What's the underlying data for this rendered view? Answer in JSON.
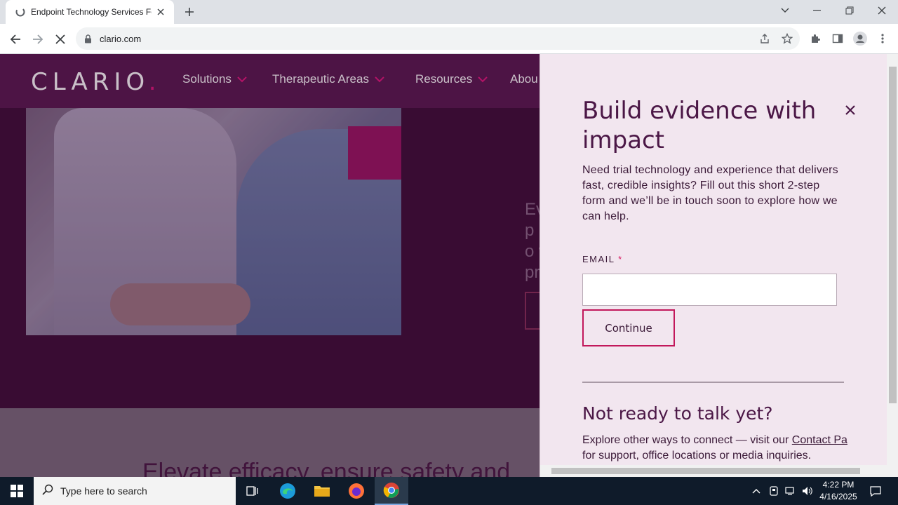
{
  "browser": {
    "tab_title": "Endpoint Technology Services Fo",
    "url": "clario.com"
  },
  "site": {
    "logo_text": "CLARIO",
    "logo_dot": ".",
    "nav": [
      "Solutions",
      "Therapeutic Areas",
      "Resources",
      "Abou"
    ],
    "hero_text_fragment": "Ev p di o w pr",
    "below_heading": "Elevate efficacy, ensure safety and"
  },
  "panel": {
    "title": "Build evidence with impact",
    "description": "Need trial technology and experience that delivers fast, credible insights? Fill out this short 2-step form and we’ll be in touch soon to explore how we can help.",
    "email_label": "EMAIL",
    "required_mark": "*",
    "email_value": "",
    "continue_label": "Continue",
    "not_ready_heading": "Not ready to talk yet?",
    "explore_line1_prefix": "Explore other ways to connect — visit our ",
    "explore_link": "Contact Pa",
    "explore_line2": "for support, office locations or media inquiries."
  },
  "taskbar": {
    "search_placeholder": "Type here to search",
    "time": "4:22 PM",
    "date": "4/16/2025"
  },
  "colors": {
    "brand_plum": "#5a1a50",
    "brand_pink": "#e2197e",
    "panel_bg": "#f2e6ef"
  }
}
